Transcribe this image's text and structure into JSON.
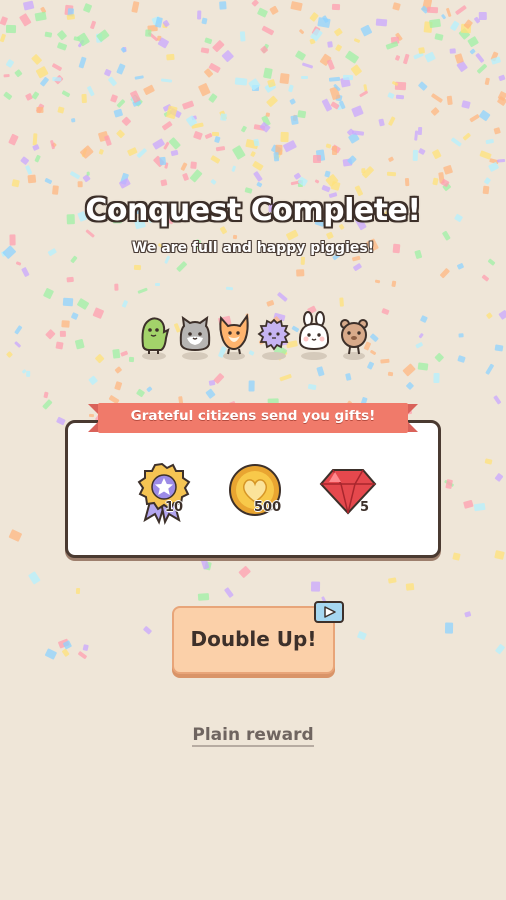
{
  "screen": {
    "title": "Conquest Complete!",
    "subtitle": "We are full and happy piggies!"
  },
  "characters": [
    {
      "name": "green-dino",
      "color": "#a3d36a"
    },
    {
      "name": "gray-cat",
      "color": "#b7b5b3"
    },
    {
      "name": "orange-fox",
      "color": "#ffb46e"
    },
    {
      "name": "purple-puffball",
      "color": "#c6b4f2"
    },
    {
      "name": "white-bunny",
      "color": "#ffffff"
    },
    {
      "name": "brown-bear",
      "color": "#d8aa8a"
    }
  ],
  "gifts": {
    "banner": "Grateful citizens send you gifts!",
    "items": [
      {
        "icon": "ribbon-medal-icon",
        "quantity": "10"
      },
      {
        "icon": "gold-heart-coin-icon",
        "quantity": "500"
      },
      {
        "icon": "red-gem-icon",
        "quantity": "5"
      }
    ]
  },
  "actions": {
    "double_up": "Double Up!",
    "double_up_icon": "video-play-icon",
    "plain_reward": "Plain reward"
  },
  "colors": {
    "background": "#efe6d8",
    "banner": "#f07a6a",
    "button": "#fbd0a9",
    "button_border": "#e8a579",
    "video_badge": "#a6d7f0"
  }
}
